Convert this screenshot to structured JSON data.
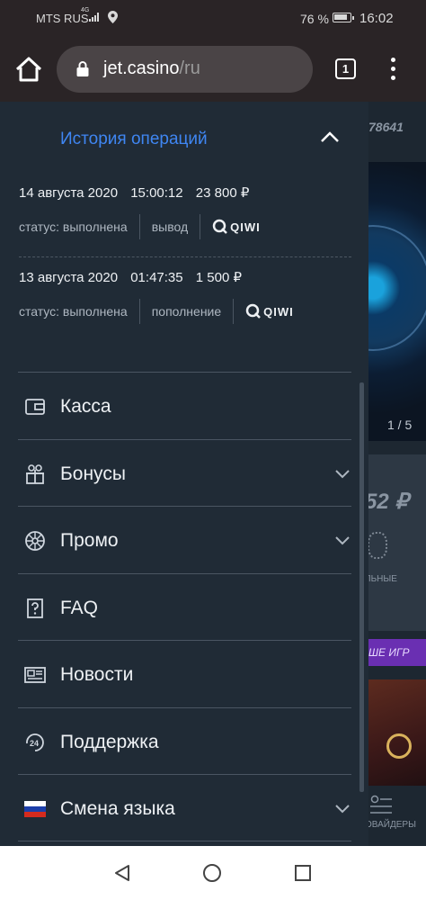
{
  "status_bar": {
    "carrier": "MTS RUS",
    "network": "4G",
    "battery": "76 %",
    "time": "16:02"
  },
  "browser": {
    "url_host": "jet.casino",
    "url_path": "/ru",
    "tab_count": "1"
  },
  "background_page": {
    "account_id": "78641",
    "slider_pager": "1 / 5",
    "balance": "52 ₽",
    "category_label": "ЛЬНЫЕ",
    "banner_text": "ШЕ ИГР",
    "providers_label": "ОВАЙДЕРЫ"
  },
  "history": {
    "title": "История операций",
    "operations": [
      {
        "date": "14 августа 2020",
        "time": "15:00:12",
        "amount": "23 800 ₽",
        "status": "статус: выполнена",
        "type": "вывод",
        "method": "QIWI"
      },
      {
        "date": "13 августа 2020",
        "time": "01:47:35",
        "amount": "1 500 ₽",
        "status": "статус: выполнена",
        "type": "пополнение",
        "method": "QIWI"
      }
    ]
  },
  "menu": {
    "items": [
      {
        "label": "Касса",
        "icon": "wallet-icon"
      },
      {
        "label": "Бонусы",
        "icon": "gift-icon"
      },
      {
        "label": "Промо",
        "icon": "wheel-icon"
      },
      {
        "label": "FAQ",
        "icon": "question-icon"
      },
      {
        "label": "Новости",
        "icon": "newspaper-icon"
      },
      {
        "label": "Поддержка",
        "icon": "support-24-icon"
      },
      {
        "label": "Смена языка",
        "icon": "russian-flag-icon"
      }
    ]
  },
  "colors": {
    "drawer_bg": "#202b36",
    "accent": "#3f86f2",
    "chrome_bg": "#2a2426"
  }
}
